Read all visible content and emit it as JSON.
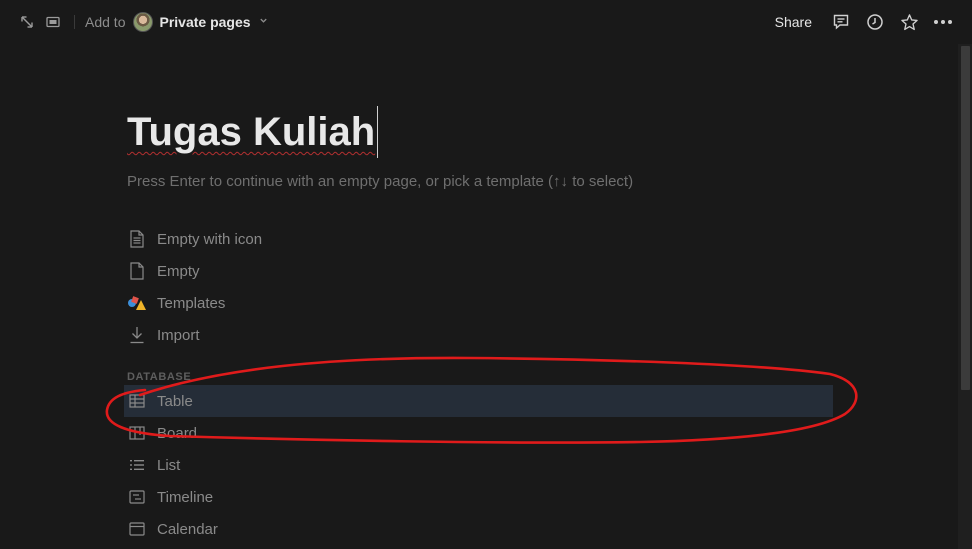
{
  "topbar": {
    "add_to": "Add to",
    "page_name": "Private pages",
    "share": "Share",
    "icons": [
      "expand-icon",
      "peek-mode-icon",
      "comment-icon",
      "clock-icon",
      "star-icon",
      "more-icon"
    ]
  },
  "page": {
    "title": "Tugas Kuliah",
    "hint": "Press Enter to continue with an empty page, or pick a template (↑↓ to select)"
  },
  "options": [
    {
      "label": "Empty with icon",
      "icon": "page-lines-icon"
    },
    {
      "label": "Empty",
      "icon": "page-icon"
    },
    {
      "label": "Templates",
      "icon": "templates-shapes-icon"
    },
    {
      "label": "Import",
      "icon": "download-arrow-icon"
    }
  ],
  "database": {
    "section_label": "DATABASE",
    "items": [
      {
        "label": "Table",
        "icon": "table-icon",
        "selected": true
      },
      {
        "label": "Board",
        "icon": "board-icon"
      },
      {
        "label": "List",
        "icon": "list-icon"
      },
      {
        "label": "Timeline",
        "icon": "timeline-icon"
      },
      {
        "label": "Calendar",
        "icon": "calendar-icon"
      }
    ]
  },
  "colors": {
    "background": "#191919",
    "selected_row": "#252d38",
    "annotation": "#e01b1b",
    "spellcheck": "#b33030"
  }
}
